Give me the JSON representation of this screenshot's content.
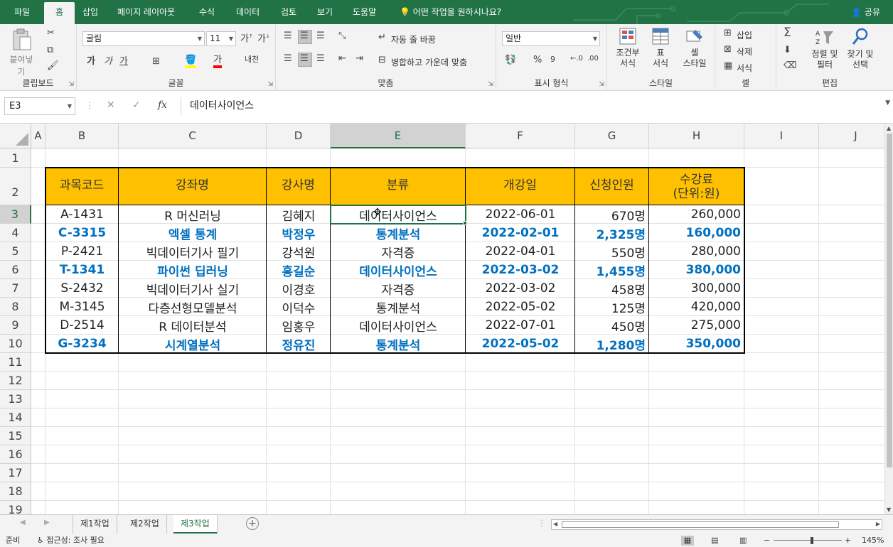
{
  "ribbon_tabs": [
    "파일",
    "홈",
    "삽입",
    "페이지 레이아웃",
    "수식",
    "데이터",
    "검토",
    "보기",
    "도움말"
  ],
  "active_tab": "홈",
  "tell_me": "어떤 작업을 원하시나요?",
  "share_label": "공유",
  "clipboard": {
    "paste_label": "붙여넣기",
    "group_label": "클립보드"
  },
  "font": {
    "name": "굴림",
    "size": "11",
    "bold": "가",
    "italic": "가",
    "underline": "가",
    "phonetic": "내천",
    "group_label": "글꼴"
  },
  "alignment": {
    "wrap_text": "자동 줄 바꿈",
    "merge_center": "병합하고 가운데 맞춤",
    "group_label": "맞춤"
  },
  "number": {
    "format": "일반",
    "percent": "%",
    "group_label": "표시 형식"
  },
  "styles": {
    "conditional": [
      "조건부",
      "서식"
    ],
    "table": [
      "표",
      "서식"
    ],
    "cell": [
      "셀",
      "스타일"
    ],
    "group_label": "스타일"
  },
  "cells": {
    "insert": "삽입",
    "delete": "삭제",
    "format": "서식",
    "group_label": "셀"
  },
  "editing": {
    "sort": [
      "정렬 및",
      "필터"
    ],
    "find": [
      "찾기 및",
      "선택"
    ],
    "group_label": "편집"
  },
  "name_box": "E3",
  "formula_value": "데이터사이언스",
  "fx_label": "fx",
  "columns": [
    "A",
    "B",
    "C",
    "D",
    "E",
    "F",
    "G",
    "H",
    "I",
    "J"
  ],
  "selected_column": "E",
  "row_numbers": [
    "1",
    "2",
    "3",
    "4",
    "5",
    "6",
    "7",
    "8",
    "9",
    "10",
    "11",
    "12",
    "13",
    "14",
    "15",
    "16",
    "17",
    "18",
    "19"
  ],
  "selected_row": "3",
  "table": {
    "headers": [
      "과목코드",
      "강좌명",
      "강사명",
      "분류",
      "개강일",
      "신청인원",
      "수강료",
      "(단위:원)"
    ],
    "rows": [
      {
        "code": "A-1431",
        "course": "R 머신러닝",
        "instructor": "김혜지",
        "category": "데이터사이언스",
        "date": "2022-06-01",
        "count": "670명",
        "fee": "260,000"
      },
      {
        "code": "C-3315",
        "course": "엑셀 통계",
        "instructor": "박정우",
        "category": "통계분석",
        "date": "2022-02-01",
        "count": "2,325명",
        "fee": "160,000"
      },
      {
        "code": "P-2421",
        "course": "빅데이터기사 필기",
        "instructor": "강석원",
        "category": "자격증",
        "date": "2022-04-01",
        "count": "550명",
        "fee": "280,000"
      },
      {
        "code": "T-1341",
        "course": "파이썬 딥러닝",
        "instructor": "홍길순",
        "category": "데이터사이언스",
        "date": "2022-03-02",
        "count": "1,455명",
        "fee": "380,000"
      },
      {
        "code": "S-2432",
        "course": "빅데이터기사 실기",
        "instructor": "이경호",
        "category": "자격증",
        "date": "2022-03-02",
        "count": "458명",
        "fee": "300,000"
      },
      {
        "code": "M-3145",
        "course": "다층선형모델분석",
        "instructor": "이덕수",
        "category": "통계분석",
        "date": "2022-05-02",
        "count": "125명",
        "fee": "420,000"
      },
      {
        "code": "D-2514",
        "course": "R 데이터분석",
        "instructor": "임홍우",
        "category": "데이터사이언스",
        "date": "2022-07-01",
        "count": "450명",
        "fee": "275,000"
      },
      {
        "code": "G-3234",
        "course": "시계열분석",
        "instructor": "정유진",
        "category": "통계분석",
        "date": "2022-05-02",
        "count": "1,280명",
        "fee": "350,000"
      }
    ],
    "highlighted_rows": [
      1,
      3,
      7
    ],
    "highlight_color": "#0070c0",
    "header_fill": "#ffc000"
  },
  "sheets": [
    "제1작업",
    "제2작업",
    "제3작업"
  ],
  "active_sheet": "제3작업",
  "status": {
    "ready": "준비",
    "accessibility": "접근성: 조사 필요",
    "zoom": "145%"
  },
  "colors": {
    "brand": "#217346"
  }
}
